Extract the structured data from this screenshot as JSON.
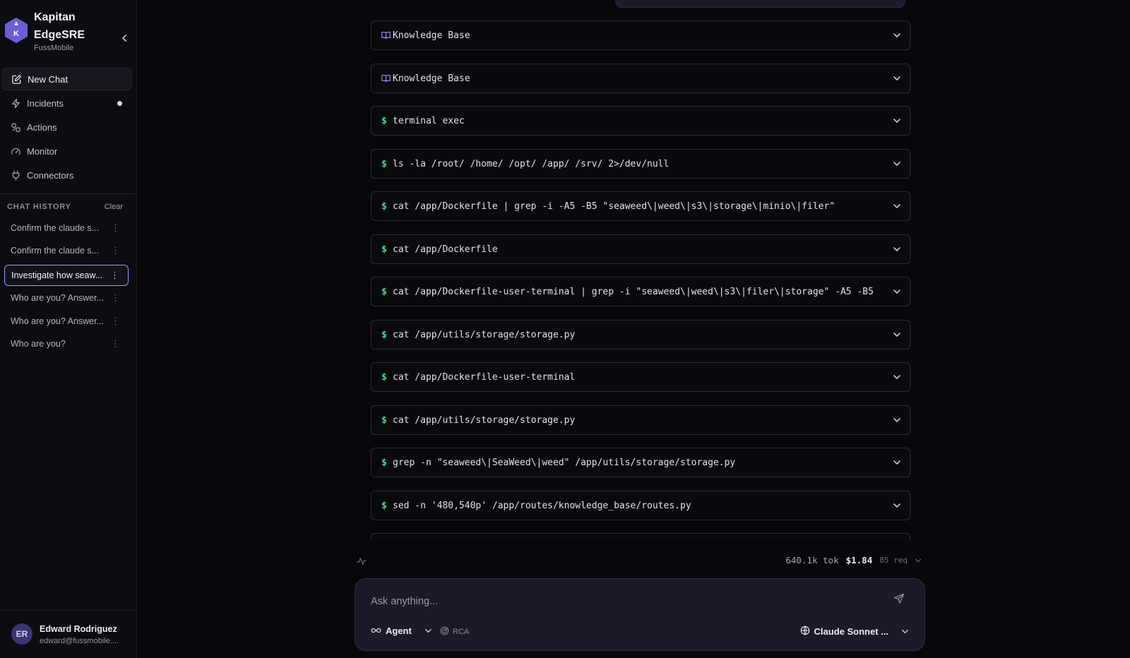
{
  "brand": {
    "logo_letter": "K",
    "name": "Kapitan EdgeSRE",
    "org": "FussMobile"
  },
  "nav": {
    "items": [
      {
        "label": "New Chat",
        "icon": "edit-icon"
      },
      {
        "label": "Incidents",
        "icon": "bolt-icon"
      },
      {
        "label": "Actions",
        "icon": "shapes-icon"
      },
      {
        "label": "Monitor",
        "icon": "gauge-icon"
      },
      {
        "label": "Connectors",
        "icon": "plug-icon"
      }
    ]
  },
  "history": {
    "title": "CHAT HISTORY",
    "clear_label": "Clear",
    "items": [
      {
        "label": "Confirm the claude s..."
      },
      {
        "label": "Confirm the claude s..."
      },
      {
        "label": "Investigate how seaw...",
        "selected": true
      },
      {
        "label": "Who are you? Answer..."
      },
      {
        "label": "Who are you? Answer..."
      },
      {
        "label": "Who are you?"
      }
    ]
  },
  "user": {
    "initials": "ER",
    "name": "Edward Rodriguez",
    "email": "edward@fussmobile...."
  },
  "tool_calls": [
    {
      "prefix": "book-icon",
      "label": "Knowledge Base"
    },
    {
      "prefix": "book-icon",
      "label": "Knowledge Base"
    },
    {
      "prefix": "$",
      "label": "terminal exec"
    },
    {
      "prefix": "$",
      "label": "ls -la /root/ /home/ /opt/ /app/ /srv/ 2>/dev/null"
    },
    {
      "prefix": "$",
      "label": "cat /app/Dockerfile | grep -i -A5 -B5 \"seaweed\\|weed\\|s3\\|storage\\|minio\\|filer\""
    },
    {
      "prefix": "$",
      "label": "cat /app/Dockerfile"
    },
    {
      "prefix": "$",
      "label": "cat /app/Dockerfile-user-terminal | grep -i \"seaweed\\|weed\\|s3\\|filer\\|storage\" -A5 -B5"
    },
    {
      "prefix": "$",
      "label": "cat /app/utils/storage/storage.py"
    },
    {
      "prefix": "$",
      "label": "cat /app/Dockerfile-user-terminal"
    },
    {
      "prefix": "$",
      "label": "cat /app/utils/storage/storage.py"
    },
    {
      "prefix": "$",
      "label": "grep -n \"seaweed\\|SeaWeed\\|weed\" /app/utils/storage/storage.py"
    },
    {
      "prefix": "$",
      "label": "sed -n '480,540p' /app/routes/knowledge_base/routes.py"
    },
    {
      "prefix": "$",
      "label": ""
    }
  ],
  "stats": {
    "tokens": "640.1k tok",
    "cost": "$1.84",
    "requests": "85 req"
  },
  "composer": {
    "placeholder": "Ask anything...",
    "mode_label": "Agent",
    "rca_label": "RCA",
    "model_label": "Claude Sonnet ..."
  },
  "colors": {
    "accent": "#6b5fd3",
    "prompt_green": "#4ade80",
    "kb_purple": "#a78bfa",
    "selected_border": "#8ea0ff"
  }
}
